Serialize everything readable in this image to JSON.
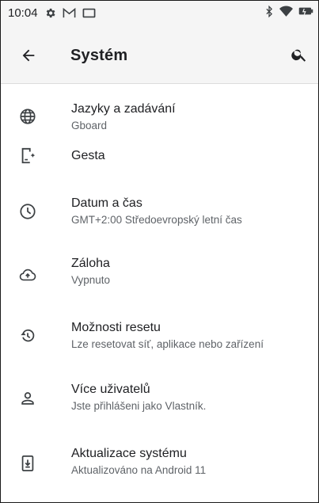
{
  "status_bar": {
    "time": "10:04",
    "icons_left": [
      "settings-icon",
      "gmail-icon",
      "screen-icon"
    ],
    "icons_right": [
      "bluetooth-icon",
      "wifi-icon",
      "battery-icon"
    ]
  },
  "app_bar": {
    "title": "Systém",
    "back_icon": "arrow-back-icon",
    "search_icon": "search-icon"
  },
  "items": [
    {
      "icon": "language-icon",
      "title": "Jazyky a zadávání",
      "subtitle": "Gboard"
    },
    {
      "icon": "gestures-icon",
      "title": "Gesta",
      "subtitle": ""
    },
    {
      "icon": "clock-icon",
      "title": "Datum a čas",
      "subtitle": "GMT+2:00 Středoevropský letní čas"
    },
    {
      "icon": "cloud-upload-icon",
      "title": "Záloha",
      "subtitle": "Vypnuto"
    },
    {
      "icon": "reset-history-icon",
      "title": "Možnosti resetu",
      "subtitle": "Lze resetovat síť, aplikace nebo zařízení"
    },
    {
      "icon": "person-icon",
      "title": "Více uživatelů",
      "subtitle": "Jste přihlášeni jako Vlastník."
    },
    {
      "icon": "system-update-icon",
      "title": "Aktualizace systému",
      "subtitle": "Aktualizováno na Android 11"
    }
  ],
  "colors": {
    "background": "#ffffff",
    "bar_background": "#f5f5f5",
    "primary_text": "#202124",
    "secondary_text": "#5f6368"
  }
}
